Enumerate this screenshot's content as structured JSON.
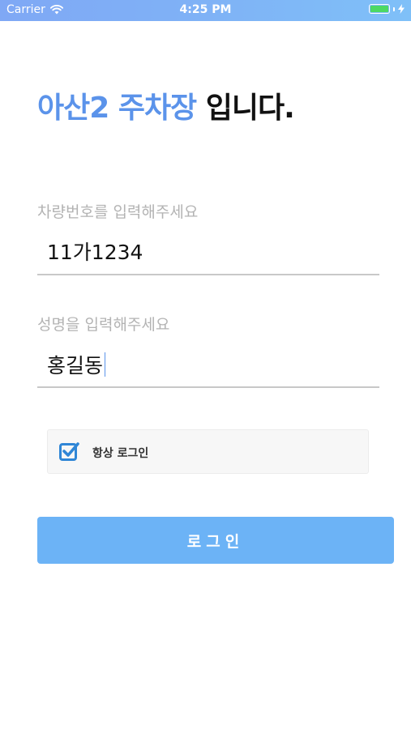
{
  "status_bar": {
    "carrier": "Carrier",
    "time": "4:25 PM",
    "icons": [
      "wifi-icon",
      "battery-icon",
      "charging-bolt-icon"
    ],
    "battery_level": 1.0
  },
  "header": {
    "title_accent": "아산2 주차장",
    "title_rest": " 입니다."
  },
  "form": {
    "vehicle": {
      "label": "차량번호를 입력해주세요",
      "value": "11가1234"
    },
    "name": {
      "label": "성명을 입력해주세요",
      "value": "홍길동"
    },
    "remember": {
      "label": "항상 로그인",
      "checked": true
    },
    "login_button": "로그인"
  },
  "colors": {
    "accent": "#5b93ea",
    "button": "#6cb3f6",
    "battery": "#4cd964"
  }
}
